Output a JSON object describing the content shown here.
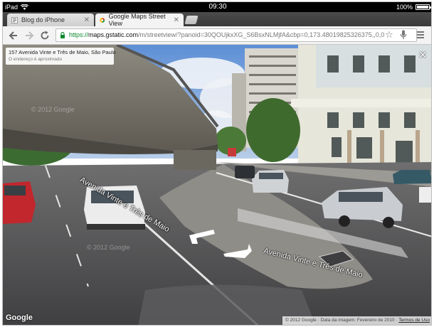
{
  "status_bar": {
    "device": "iPad",
    "time": "09:30",
    "battery_percent": "100%",
    "battery_level": 1.0
  },
  "tabs": [
    {
      "title": "Blog do iPhone",
      "active": false
    },
    {
      "title": "Google Maps Street View",
      "active": true
    }
  ],
  "toolbar": {
    "url_scheme": "https://",
    "url_host": "maps.gstatic.com",
    "url_rest": "/m/streetview/?panoid=30QOUjkxXG_S6BsxNLMjfA&cbp=0,173.48019825326375,,0,0"
  },
  "streetview": {
    "address": "157 Avenida Vinte e Três de Maio, São Paulo",
    "address_note": "O endereço é aproximado",
    "street_label_1": "Avenida Vinte e Três de Maio",
    "street_label_2": "Avenida Vinte e Três de Maio",
    "watermark_1": "© 2012 Google",
    "watermark_2": "© 2012 Google",
    "logo": "Google",
    "attribution": "© 2012 Google · Data da imagem: Fevereiro de 2010 ·",
    "terms": "Termos de Uso"
  },
  "colors": {
    "secure_green": "#0b8a2f",
    "chrome_favicon_red": "#db4437",
    "chrome_favicon_yellow": "#f4b400",
    "chrome_favicon_green": "#0f9d58"
  }
}
